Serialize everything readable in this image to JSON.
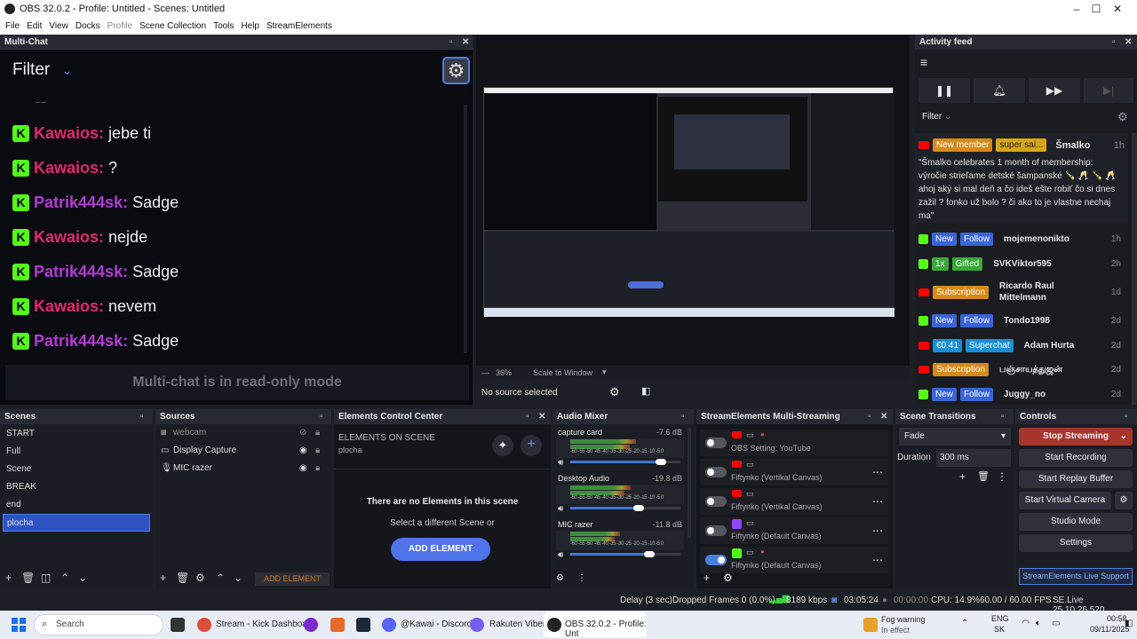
{
  "window": {
    "title": "OBS 32.0.2 - Profile: Untitled - Scenes: Untitled"
  },
  "menu": [
    "File",
    "Edit",
    "View",
    "Docks",
    "Profile",
    "Scene Collection",
    "Tools",
    "Help",
    "StreamElements"
  ],
  "multichat": {
    "title": "Multi-Chat",
    "filter_label": "Filter",
    "readonly": "Multi-chat is in read-only mode",
    "messages": [
      {
        "user": "Kawaios:",
        "text": "jebe ti",
        "color": "#e2286c"
      },
      {
        "user": "Kawaios:",
        "text": "?",
        "color": "#e2286c"
      },
      {
        "user": "Patrik444sk:",
        "text": "Sadge",
        "color": "#b43ad6"
      },
      {
        "user": "Kawaios:",
        "text": "nejde",
        "color": "#e2286c"
      },
      {
        "user": "Patrik444sk:",
        "text": "Sadge",
        "color": "#b43ad6"
      },
      {
        "user": "Kawaios:",
        "text": "nevem",
        "color": "#e2286c"
      },
      {
        "user": "Patrik444sk:",
        "text": "Sadge",
        "color": "#b43ad6"
      }
    ]
  },
  "preview": {
    "zoom": "36%",
    "scale_mode": "Scale to Window",
    "no_source": "No source selected"
  },
  "activity": {
    "title": "Activity feed",
    "filter_label": "Filter",
    "membership": {
      "tag1": "New member",
      "tag2": "super sai...",
      "user": "Šmalko",
      "time": "1h",
      "message": "\"Šmalko celebrates 1 month of membership: výročie strieľame detské šampanské 🍾 🥂 🍾 🥂 ahoj aký si mal deň a čo ideš ešte robiť čo si dnes zažil ? fonko už bolo ? či ako to je vlastne nechaj ma\""
    },
    "rows": [
      {
        "platform": "kick",
        "tags": [
          "New",
          "Follow"
        ],
        "tagcolors": [
          "#3a64d8",
          "#3a64d8"
        ],
        "user": "mojemenonikto",
        "time": "1h"
      },
      {
        "platform": "kick",
        "tags": [
          "1x",
          "Gifted"
        ],
        "tagcolors": [
          "#3aa83a",
          "#3aa83a"
        ],
        "user": "SVKViktor595",
        "time": "2h"
      },
      {
        "platform": "yt",
        "tags": [
          "Subscription"
        ],
        "tagcolors": [
          "#d68a1a"
        ],
        "user": "Ricardo Raul Mittelmann",
        "time": "1d"
      },
      {
        "platform": "kick",
        "tags": [
          "New",
          "Follow"
        ],
        "tagcolors": [
          "#3a64d8",
          "#3a64d8"
        ],
        "user": "Tondo1998",
        "time": "2d"
      },
      {
        "platform": "yt",
        "tags": [
          "€0.41",
          "Superchat"
        ],
        "tagcolors": [
          "#1a8fd6",
          "#1a8fd6"
        ],
        "user": "Adam Hurta",
        "time": "2d"
      },
      {
        "platform": "yt",
        "tags": [
          "Subscription"
        ],
        "tagcolors": [
          "#d68a1a"
        ],
        "user": "பஞ்சாயத்துஜன்",
        "time": "2d"
      },
      {
        "platform": "kick",
        "tags": [
          "New",
          "Follow"
        ],
        "tagcolors": [
          "#3a64d8",
          "#3a64d8"
        ],
        "user": "Juggy_no",
        "time": "2d"
      }
    ]
  },
  "scenes": {
    "title": "Scenes",
    "items": [
      "START",
      "Full",
      "Scene",
      "BREAK",
      "end",
      "plocha"
    ],
    "selected": 5
  },
  "sources": {
    "title": "Sources",
    "items": [
      "webcam",
      "Display Capture",
      "MIC razer"
    ],
    "add_element": "ADD ELEMENT"
  },
  "ecc": {
    "title": "Elements Control Center",
    "heading": "ELEMENTS ON SCENE",
    "scene": "plocha",
    "empty": "There are no Elements in this scene",
    "hint": "Select a different Scene or",
    "button": "ADD ELEMENT"
  },
  "mixer": {
    "title": "Audio Mixer",
    "channels": [
      {
        "name": "capture card",
        "db": "-7.6 dB",
        "level": 0.6,
        "volume": 0.82
      },
      {
        "name": "Desktop Audio",
        "db": "-19.8 dB",
        "level": 0.55,
        "volume": 0.62
      },
      {
        "name": "MIC razer",
        "db": "-11.8 dB",
        "level": 0.45,
        "volume": 0.72
      }
    ],
    "scale": "-60 -55 -50 -45 -40 -35 -30 -25 -20 -15 -10 -5 0"
  },
  "multistream": {
    "title": "StreamElements Multi-Streaming",
    "rows": [
      {
        "label": "OBS Setting: YouTube",
        "on": false
      },
      {
        "label": "Fiftynko (Vertikal Canvas)",
        "on": false
      },
      {
        "label": "Fiftynko (Vertikal Canvas)",
        "on": false
      },
      {
        "label": "Fiftynko (Default Canvas)",
        "on": false
      },
      {
        "label": "Fiftynko (Default Canvas)",
        "on": true
      }
    ]
  },
  "transitions": {
    "title": "Scene Transitions",
    "current": "Fade",
    "duration_label": "Duration",
    "duration": "300 ms"
  },
  "controls": {
    "title": "Controls",
    "stop": "Stop Streaming",
    "record": "Start Recording",
    "replay": "Start Replay Buffer",
    "vcam": "Start Virtual Camera",
    "studio": "Studio Mode",
    "settings": "Settings",
    "support": "StreamElements Live Support"
  },
  "status": {
    "delay": "Delay (3 sec)",
    "dropped": "Dropped Frames 0 (0.0%)",
    "kbps": "8189 kbps",
    "live": "03:05:24",
    "rec": "00:00:00",
    "cpu": "CPU: 14.9%",
    "fps": "60.00 / 60.00 FPS",
    "version": "SE.Live 25.10.26.520"
  },
  "taskbar": {
    "search": "Search",
    "apps": [
      "Stream - Kick Dashboar",
      "@Kawai - Discord",
      "Rakuten Viber",
      "OBS 32.0.2 - Profile: Unt"
    ],
    "weather": "Fog warning",
    "weather_sub": "In effect",
    "lang": "ENG",
    "lang2": "SK",
    "time": "00:58",
    "date": "09/11/2025"
  }
}
